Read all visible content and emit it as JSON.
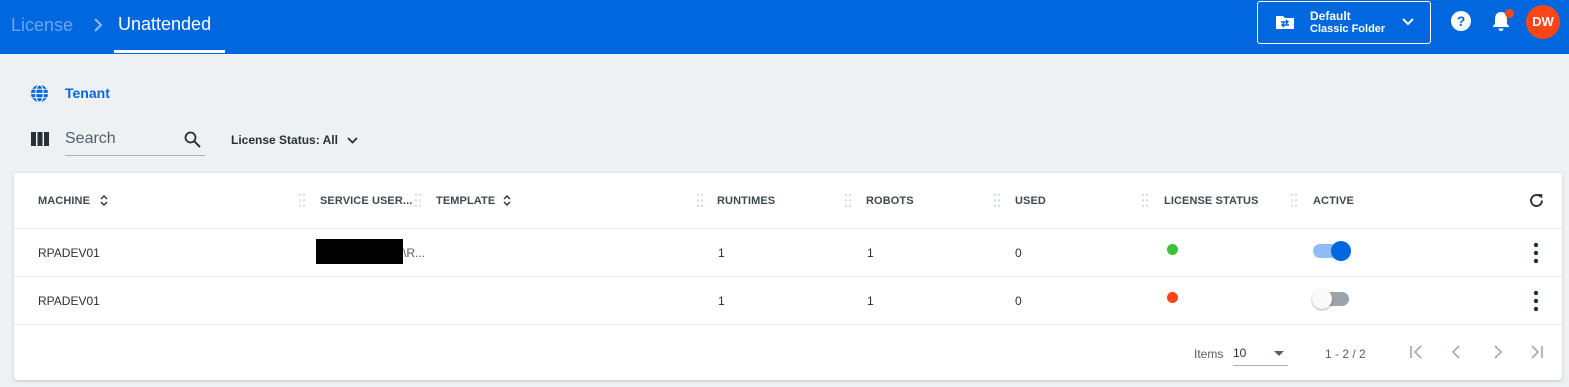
{
  "header": {
    "breadcrumb_parent": "License",
    "breadcrumb_separator": ">",
    "breadcrumb_current": "Unattended",
    "folder_title": "Default",
    "folder_subtitle": "Classic Folder",
    "help_glyph": "?",
    "avatar_initials": "DW",
    "accent_color": "#0067df",
    "notification_color": "#fa4616"
  },
  "scope": {
    "label": "Tenant",
    "icon": "globe-icon"
  },
  "toolbar": {
    "search_placeholder": "Search",
    "license_status_filter": "License Status: All"
  },
  "table": {
    "columns": [
      {
        "key": "machine",
        "label": "MACHINE",
        "sortable": true
      },
      {
        "key": "service_user",
        "label": "SERVICE USER...",
        "sortable": false
      },
      {
        "key": "template",
        "label": "TEMPLATE",
        "sortable": true
      },
      {
        "key": "runtimes",
        "label": "RUNTIMES",
        "sortable": false
      },
      {
        "key": "robots",
        "label": "ROBOTS",
        "sortable": false
      },
      {
        "key": "used",
        "label": "USED",
        "sortable": false
      },
      {
        "key": "license_status",
        "label": "LICENSE STATUS",
        "sortable": false
      },
      {
        "key": "active",
        "label": "ACTIVE",
        "sortable": false
      }
    ],
    "rows": [
      {
        "machine": "RPADEV01",
        "service_user_suffix": "\\R...",
        "service_user_redacted": true,
        "runtimes": "1",
        "robots": "1",
        "used": "0",
        "license_status_color": "#38c43c",
        "active": true
      },
      {
        "machine": "RPADEV01",
        "service_user_suffix": "",
        "service_user_redacted": false,
        "runtimes": "1",
        "robots": "1",
        "used": "0",
        "license_status_color": "#fa4616",
        "active": false
      }
    ]
  },
  "pagination": {
    "items_label": "Items",
    "page_size": "10",
    "range": "1 - 2 / 2"
  }
}
